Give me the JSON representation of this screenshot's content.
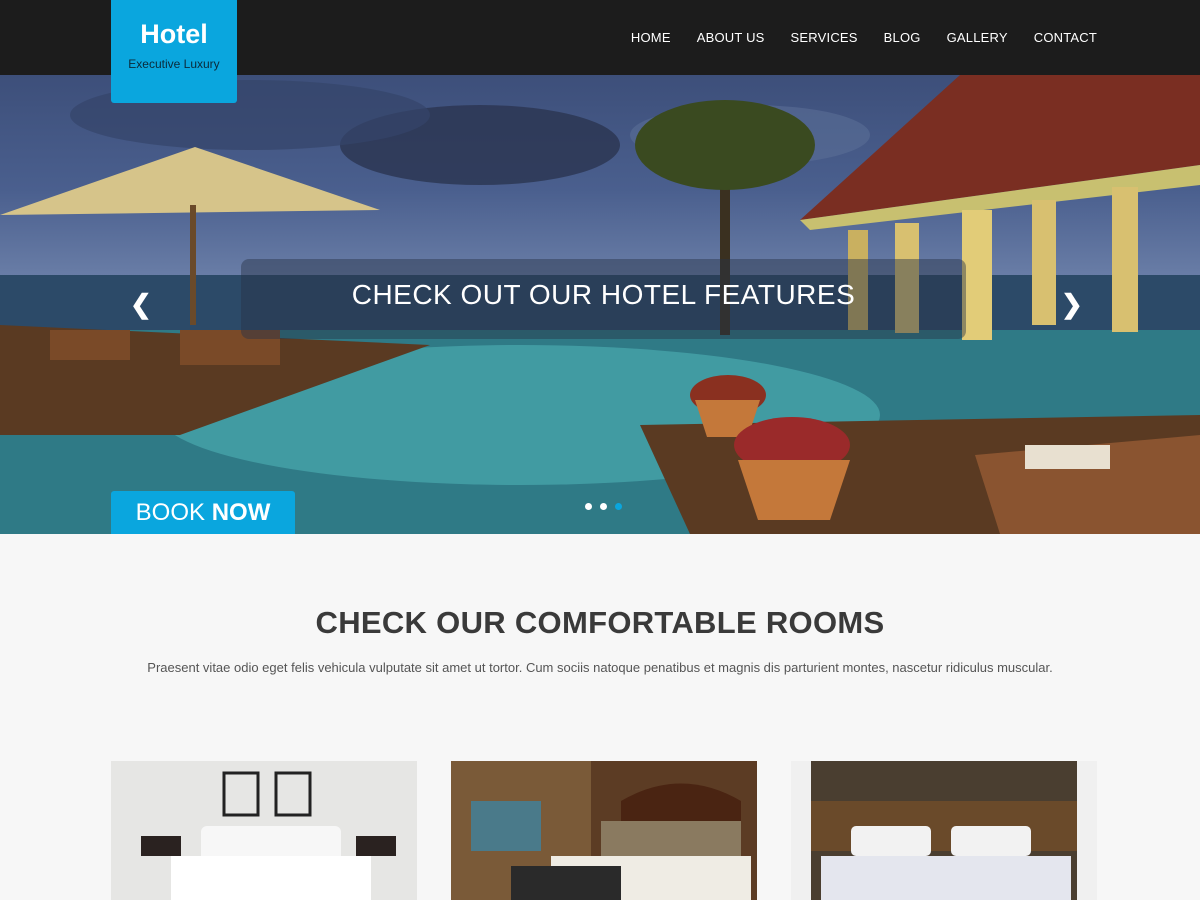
{
  "header": {
    "logo_title": "Hotel",
    "logo_subtitle": "Executive Luxury",
    "nav": [
      "HOME",
      "ABOUT US",
      "SERVICES",
      "BLOG",
      "GALLERY",
      "CONTACT"
    ]
  },
  "hero": {
    "caption": "CHECK OUT OUR HOTEL FEATURES",
    "prev_icon": "chevron-left-icon",
    "next_icon": "chevron-right-icon",
    "slides": 3,
    "active_slide": 3,
    "book_prefix": "BOOK",
    "book_bold": "NOW"
  },
  "rooms": {
    "title_prefix": "CHECK OUR COMFORTABLE",
    "title_bold": "ROOMS",
    "description": "Praesent vitae odio eget felis vehicula vulputate sit amet ut tortor. Cum sociis natoque penatibus et magnis dis parturient montes, nascetur ridiculus muscular."
  },
  "colors": {
    "accent": "#0aa6de",
    "header_bg": "#1c1c1c",
    "page_bg": "#f7f7f7"
  }
}
